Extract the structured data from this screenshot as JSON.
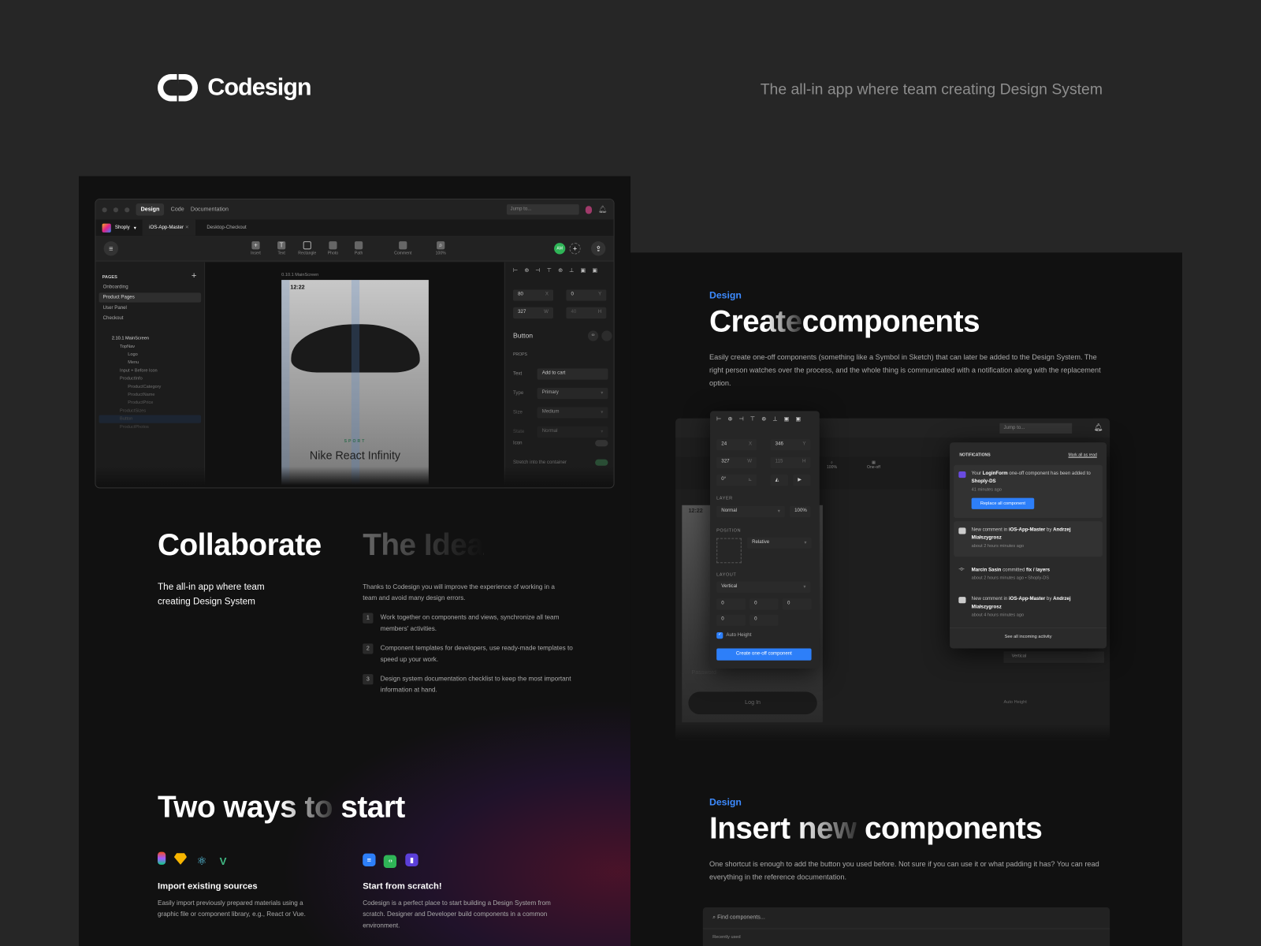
{
  "header": {
    "brand": "Codesign",
    "tagline": "The all-in app where team creating Design System"
  },
  "app": {
    "tabs": [
      "Design",
      "Code",
      "Documentation"
    ],
    "jump_placeholder": "Jump to...",
    "workspace": "Shoply",
    "files": [
      "iOS-App-Master",
      "Desktop-Checkout"
    ],
    "tools": [
      "Insert",
      "Text",
      "Rectangle",
      "Photo",
      "Path",
      "Comment",
      "100%"
    ],
    "avatar_initials": "AM",
    "pages_title": "PAGES",
    "pages": [
      "Onboarding",
      "Product Pages",
      "User Panel",
      "Checkout"
    ],
    "layers": [
      "2.10.1 MainScreen",
      "TopNav",
      "Logo",
      "Menu",
      "Input + Before Icon",
      "ProductInfo",
      "ProductCategory",
      "ProductName",
      "ProductPrice",
      "ProductSizes",
      "Button",
      "ProductPhotos"
    ],
    "frame_label": "0.10.1 MainScreen",
    "phone": {
      "time": "12:22",
      "category": "SPORT",
      "product": "Nike React Infinity"
    },
    "props": {
      "x": "80",
      "y": "0",
      "w": "327",
      "h": "40",
      "x_label": "X",
      "y_label": "Y",
      "w_label": "W",
      "h_label": "H",
      "component": "Button",
      "section": "PROPS",
      "rows": [
        {
          "label": "Text",
          "value": "Add to cart"
        },
        {
          "label": "Type",
          "value": "Primary"
        },
        {
          "label": "Size",
          "value": "Medium"
        },
        {
          "label": "State",
          "value": "Normal"
        }
      ],
      "icon_label": "Icon",
      "stretch_label": "Stretch into the container"
    }
  },
  "collaborate": {
    "title": "Collaborate",
    "ghost": "The Idea",
    "subtitle": "The all-in app where team creating Design System",
    "intro": "Thanks to Codesign you will improve the experience of working in a team and avoid many design errors.",
    "items": [
      {
        "n": "1",
        "text": "Work together on components and views, synchronize all team members' activities."
      },
      {
        "n": "2",
        "text": "Component templates for developers, use ready-made templates to speed up your work."
      },
      {
        "n": "3",
        "text": "Design system documentation checklist to keep the most important information at hand."
      }
    ]
  },
  "start": {
    "title": "Two ways to",
    "title_end": "start",
    "import_title": "Import existing sources",
    "import_text": "Easily import previously prepared materials using a graphic file or component library, e.g., React or Vue.",
    "scratch_title": "Start from scratch!",
    "scratch_text": "Codesign is a perfect place to start building a Design System from scratch. Designer and Developer build components in a common environment."
  },
  "create": {
    "eyebrow": "Design",
    "title_ghost": "Create",
    "title": "components",
    "text": "Easily create one-off components (something like a Symbol in Sketch) that can later be added to the Design System. The right person watches over the process, and the whole thing is communicated with a notification along with the replacement option.",
    "panel": {
      "x": "24",
      "y": "346",
      "w": "327",
      "h": "115",
      "rot": "0°",
      "layer_title": "LAYER",
      "blend": "Normal",
      "opacity": "100%",
      "position_title": "POSITION",
      "position": "Relative",
      "layout_title": "LAYOUT",
      "layout": "Vertical",
      "pad": "0",
      "auto_height": "Auto Height",
      "create_btn": "Create one-off component"
    },
    "toolbar_items": [
      "100%",
      "One-off"
    ],
    "phone": {
      "password": "Password",
      "login": "Log In"
    },
    "notifications": {
      "title": "NOTIFICATIONS",
      "mark_all": "Mark all as read",
      "n1_a": "Your ",
      "n1_b": "LoginForm",
      "n1_c": " one-off component has been added to ",
      "n1_d": "Shoply-DS",
      "n1_time": "41 minutes ago",
      "n1_btn": "Replace all component",
      "n2_a": "New comment in ",
      "n2_b": "iOS-App-Master",
      "n2_c": " by ",
      "n2_d": "Andrzej Miałszygrosz",
      "n2_time": "about 2 hours minutes ago",
      "n3_a": "Marcin Sasin",
      "n3_b": " committed ",
      "n3_c": "fix / layers",
      "n3_time": "about 2 hours minutes ago • Shoply-DS",
      "n4_a": "New comment in ",
      "n4_b": "iOS-App-Master",
      "n4_c": " by ",
      "n4_d": "Andrzej Miałszygrosz",
      "n4_time": "about 4 hours minutes ago",
      "see_all": "See all incoming activity"
    }
  },
  "insert": {
    "eyebrow": "Design",
    "title_ghost": "Insert new",
    "title": "components",
    "text": "One shortcut is enough to add the button you used before. Not sure if you can use it or what padding it has? You can read everything in the reference documentation.",
    "search_placeholder": "Find components...",
    "recent": "Recently used"
  },
  "colors": {
    "accent": "#2d7ff9",
    "bg": "#262626",
    "panel": "#111111"
  }
}
